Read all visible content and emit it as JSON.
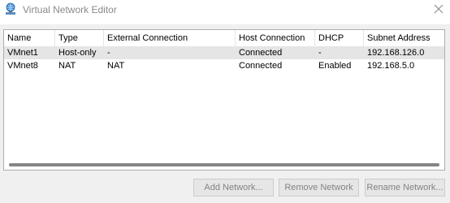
{
  "window": {
    "title": "Virtual Network Editor",
    "app_icon": "network-globe-icon",
    "close_icon": "close-icon"
  },
  "table": {
    "columns": [
      "Name",
      "Type",
      "External Connection",
      "Host Connection",
      "DHCP",
      "Subnet Address"
    ],
    "rows": [
      {
        "name": "VMnet1",
        "type": "Host-only",
        "external": "-",
        "host": "Connected",
        "dhcp": "-",
        "subnet": "192.168.126.0",
        "selected": true
      },
      {
        "name": "VMnet8",
        "type": "NAT",
        "external": "NAT",
        "host": "Connected",
        "dhcp": "Enabled",
        "subnet": "192.168.5.0",
        "selected": false
      }
    ]
  },
  "buttons": {
    "add": "Add Network...",
    "remove": "Remove Network",
    "rename": "Rename Network..."
  },
  "colors": {
    "selected_row": "#e5e5e5",
    "disabled_text": "#838383",
    "title_text": "#8a8a8a"
  }
}
